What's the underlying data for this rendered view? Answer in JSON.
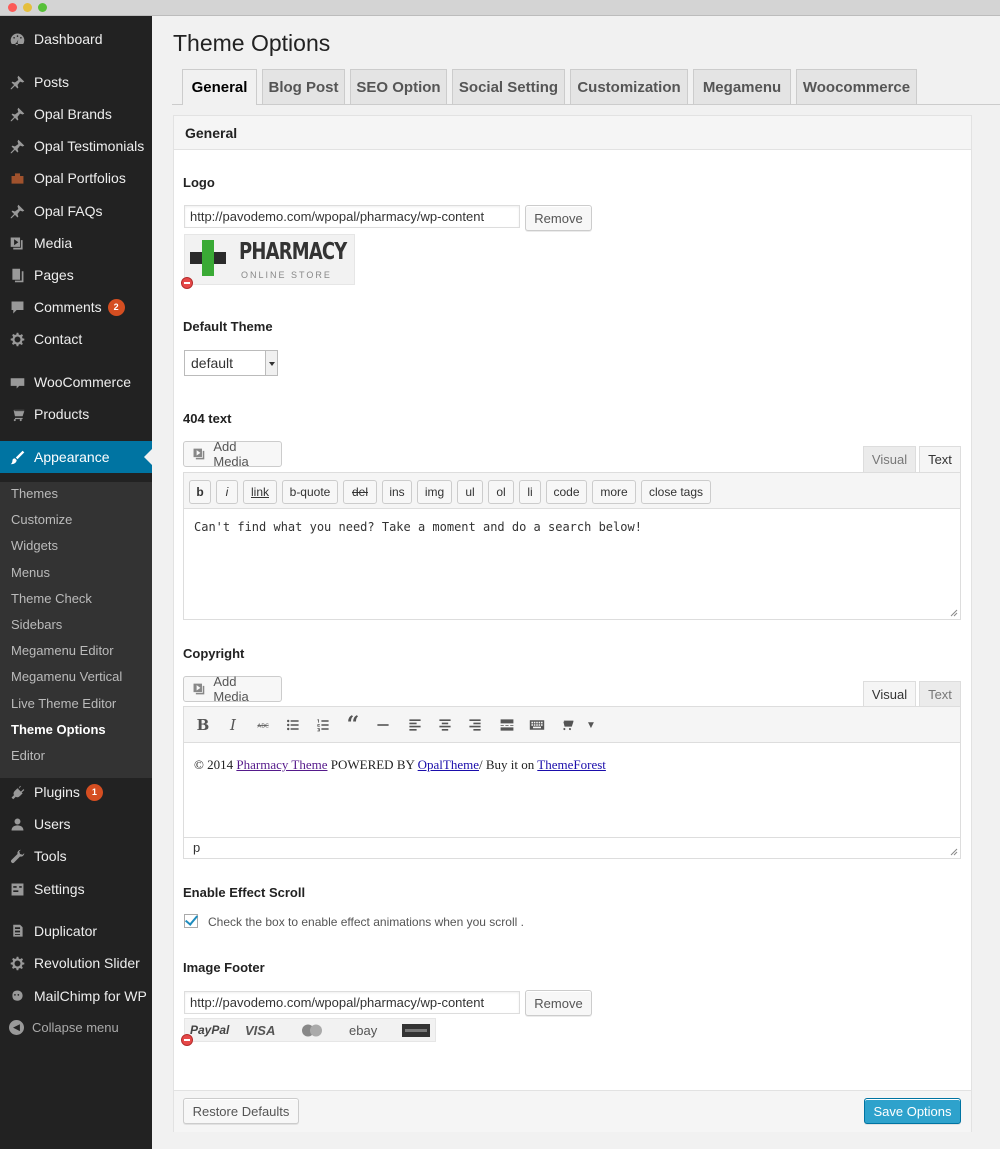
{
  "sidebar": {
    "items": [
      {
        "label": "Dashboard",
        "icon": "dashboard-icon"
      },
      {
        "label": "Posts",
        "icon": "pin-icon"
      },
      {
        "label": "Opal Brands",
        "icon": "pin-icon"
      },
      {
        "label": "Opal Testimonials",
        "icon": "pin-icon"
      },
      {
        "label": "Opal Portfolios",
        "icon": "portfolio-icon"
      },
      {
        "label": "Opal FAQs",
        "icon": "pin-icon"
      },
      {
        "label": "Media",
        "icon": "media-icon"
      },
      {
        "label": "Pages",
        "icon": "pages-icon"
      },
      {
        "label": "Comments",
        "icon": "comment-icon",
        "badge": "2"
      },
      {
        "label": "Contact",
        "icon": "gear-icon"
      },
      {
        "label": "WooCommerce",
        "icon": "woo-icon"
      },
      {
        "label": "Products",
        "icon": "cart-icon"
      },
      {
        "label": "Appearance",
        "icon": "brush-icon"
      },
      {
        "label": "Plugins",
        "icon": "plug-icon",
        "badge": "1"
      },
      {
        "label": "Users",
        "icon": "user-icon"
      },
      {
        "label": "Tools",
        "icon": "wrench-icon"
      },
      {
        "label": "Settings",
        "icon": "settings-icon"
      },
      {
        "label": "Duplicator",
        "icon": "duplicator-icon"
      },
      {
        "label": "Revolution Slider",
        "icon": "gear-icon"
      },
      {
        "label": "MailChimp for WP",
        "icon": "mailchimp-icon"
      }
    ],
    "submenu": [
      "Themes",
      "Customize",
      "Widgets",
      "Menus",
      "Theme Check",
      "Sidebars",
      "Megamenu Editor",
      "Megamenu Vertical",
      "Live Theme Editor",
      "Theme Options",
      "Editor"
    ],
    "collapse_label": "Collapse menu"
  },
  "page": {
    "title": "Theme Options"
  },
  "tabs": [
    "General",
    "Blog Post",
    "SEO Option",
    "Social Setting",
    "Customization",
    "Megamenu",
    "Woocommerce"
  ],
  "panel": {
    "heading": "General"
  },
  "logo": {
    "label": "Logo",
    "url": "http://pavodemo.com/wpopal/pharmacy/wp-content",
    "remove_label": "Remove",
    "brand_text": "PHARMACY",
    "brand_sub": "ONLINE STORE"
  },
  "default_theme": {
    "label": "Default Theme",
    "value": "default"
  },
  "text404": {
    "label": "404 text",
    "add_media": "Add Media",
    "tab_visual": "Visual",
    "tab_text": "Text",
    "qt_buttons": [
      "b",
      "i",
      "link",
      "b-quote",
      "del",
      "ins",
      "img",
      "ul",
      "ol",
      "li",
      "code",
      "more",
      "close tags"
    ],
    "content": "Can't find what you need? Take a moment and do a search below!"
  },
  "copyright": {
    "label": "Copyright",
    "add_media": "Add Media",
    "tab_visual": "Visual",
    "tab_text": "Text",
    "prefix": "© 2014 ",
    "link1": "Pharmacy Theme",
    "middle": " POWERED BY ",
    "link2": "OpalTheme",
    "middle2": "/ Buy it on ",
    "link3": "ThemeForest",
    "path": "p"
  },
  "effect_scroll": {
    "label": "Enable Effect Scroll",
    "checkbox_text": "Check the box to enable effect animations when you scroll .",
    "checked": true
  },
  "image_footer": {
    "label": "Image Footer",
    "url": "http://pavodemo.com/wpopal/pharmacy/wp-content",
    "remove_label": "Remove",
    "payments": [
      "PayPal",
      "VISA",
      "ebay"
    ]
  },
  "footer": {
    "restore_label": "Restore Defaults",
    "save_label": "Save Options"
  },
  "colors": {
    "accent": "#0074a2",
    "sidebar_bg": "#222222",
    "primary_button": "#2ea2cc",
    "badge": "#d54e21"
  }
}
